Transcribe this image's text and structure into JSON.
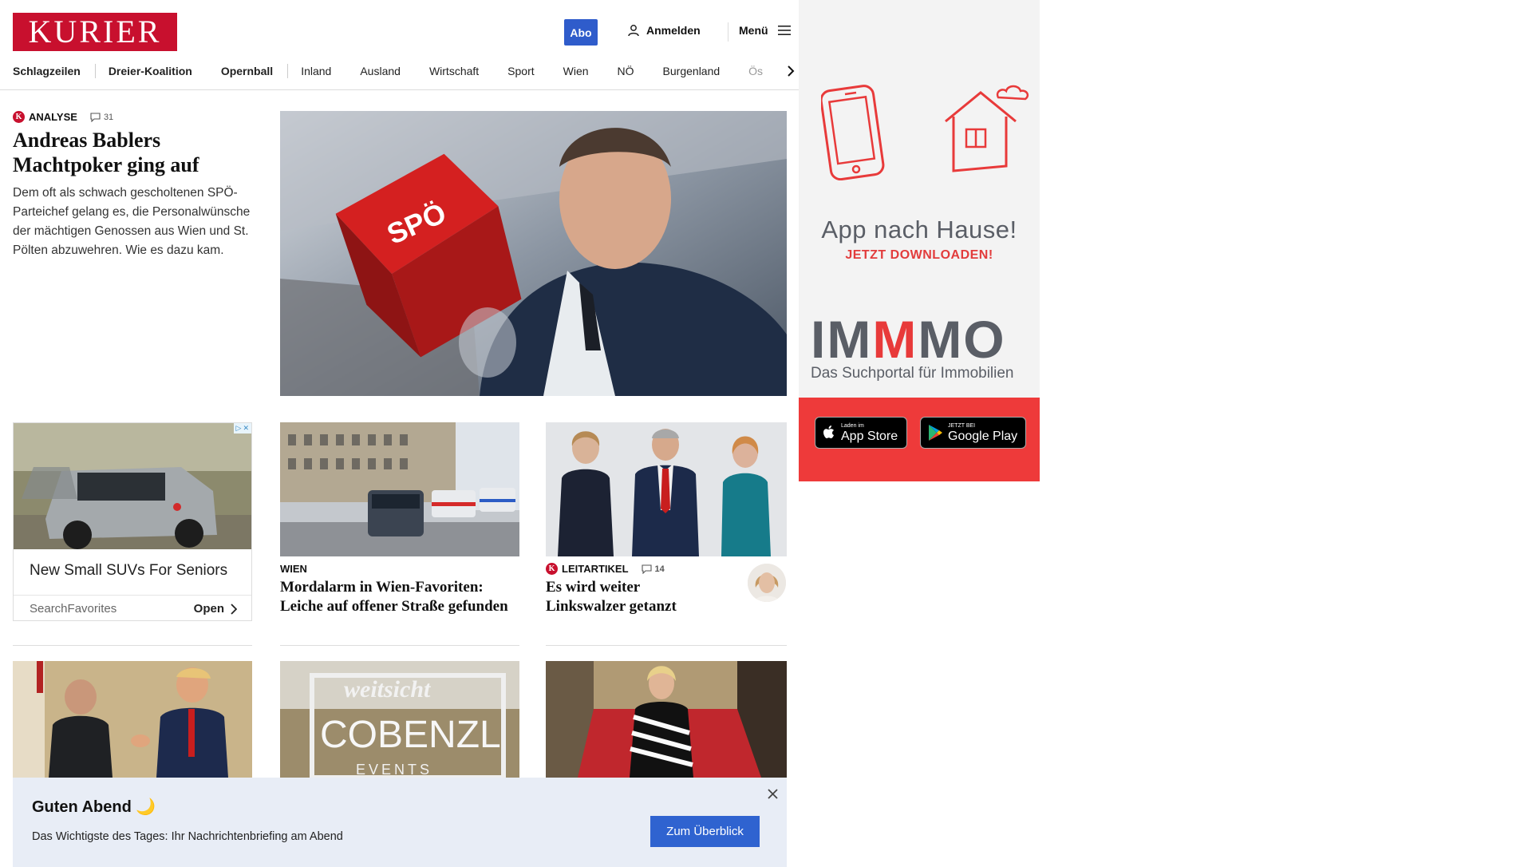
{
  "header": {
    "logo_text": "KURIER",
    "abo_label": "Abo",
    "login_label": "Anmelden",
    "menu_label": "Menü"
  },
  "nav": {
    "items": [
      "Schlagzeilen",
      "Dreier-Koalition",
      "Opernball",
      "Inland",
      "Ausland",
      "Wirtschaft",
      "Sport",
      "Wien",
      "NÖ",
      "Burgenland",
      "Ös"
    ]
  },
  "lead": {
    "kicker": "ANALYSE",
    "comments": "31",
    "title": "Andreas Bablers Machtpoker ging auf",
    "teaser": "Dem oft als schwach gescholtenen SPÖ-Parteichef gelang es, die Personalwünsche der mächtigen Genossen aus Wien und St. Pölten abzuwehren. Wie es dazu kam.",
    "hero_cube_text": "SPÖ"
  },
  "ad": {
    "title": "New Small SUVs For Seniors",
    "source": "SearchFavorites",
    "open_label": "Open"
  },
  "cards": [
    {
      "kicker": "WIEN",
      "title": "Mordalarm in Wien-Favoriten: Leiche auf offener Straße gefunden"
    },
    {
      "kicker": "LEITARTIKEL",
      "comments": "14",
      "title": "Es wird weiter Linkswalzer getanzt"
    }
  ],
  "row3": {
    "sign_text_1": "weitsicht",
    "sign_text_2": "COBENZL",
    "sign_text_3": "EVENTS"
  },
  "sidebar_ad": {
    "headline": "App nach Hause!",
    "cta": "JETZT DOWNLOADEN!",
    "brand_parts": [
      "IM",
      "M",
      "MO"
    ],
    "brand_sub": "Das Suchportal für Immobilien",
    "appstore_small": "Laden im",
    "appstore_big": "App Store",
    "googleplay_small": "JETZT BEI",
    "googleplay_big": "Google Play"
  },
  "banner": {
    "title": "Guten Abend 🌙",
    "text": "Das Wichtigste des Tages: Ihr Nachrichtenbriefing am Abend",
    "button": "Zum Überblick"
  },
  "colors": {
    "brand_red": "#c8102e",
    "abo_blue": "#2f5ccb",
    "banner_bg": "#e8edf6",
    "immmo_red": "#e83a3a"
  }
}
